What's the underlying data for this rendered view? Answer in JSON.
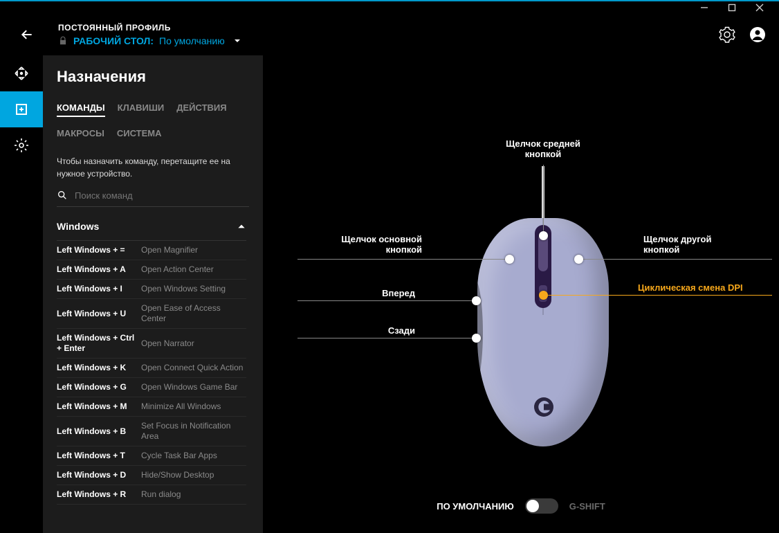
{
  "header": {
    "profile_label": "ПОСТОЯННЫЙ ПРОФИЛЬ",
    "desktop_label": "РАБОЧИЙ СТОЛ:",
    "desktop_value": "По умолчанию"
  },
  "panel": {
    "title": "Назначения",
    "tabs": [
      "КОМАНДЫ",
      "КЛАВИШИ",
      "ДЕЙСТВИЯ",
      "МАКРОСЫ",
      "СИСТЕМА"
    ],
    "hint": "Чтобы назначить команду, перетащите ее на нужное устройство.",
    "search_placeholder": "Поиск команд",
    "group": "Windows",
    "commands": [
      {
        "key": "Left Windows + =",
        "desc": "Open Magnifier"
      },
      {
        "key": "Left Windows + A",
        "desc": "Open Action Center"
      },
      {
        "key": "Left Windows + I",
        "desc": "Open Windows Setting"
      },
      {
        "key": "Left Windows + U",
        "desc": "Open Ease of Access Center"
      },
      {
        "key": "Left Windows + Ctrl + Enter",
        "desc": "Open Narrator"
      },
      {
        "key": "Left Windows + K",
        "desc": "Open Connect Quick Action"
      },
      {
        "key": "Left Windows + G",
        "desc": "Open Windows Game Bar"
      },
      {
        "key": "Left Windows + M",
        "desc": "Minimize All Windows"
      },
      {
        "key": "Left Windows + B",
        "desc": "Set Focus in Notification Area"
      },
      {
        "key": "Left Windows + T",
        "desc": "Cycle Task Bar Apps"
      },
      {
        "key": "Left Windows + D",
        "desc": "Hide/Show Desktop"
      },
      {
        "key": "Left Windows + R",
        "desc": "Run dialog"
      }
    ]
  },
  "mouse": {
    "callouts": {
      "middle": "Щелчок средней\nкнопкой",
      "primary": "Щелчок основной\nкнопкой",
      "secondary": "Щелчок другой\nкнопкой",
      "forward": "Вперед",
      "back": "Сзади",
      "dpi": "Циклическая смена DPI"
    }
  },
  "toggle": {
    "left": "ПО УМОЛЧАНИЮ",
    "right": "G-SHIFT"
  }
}
